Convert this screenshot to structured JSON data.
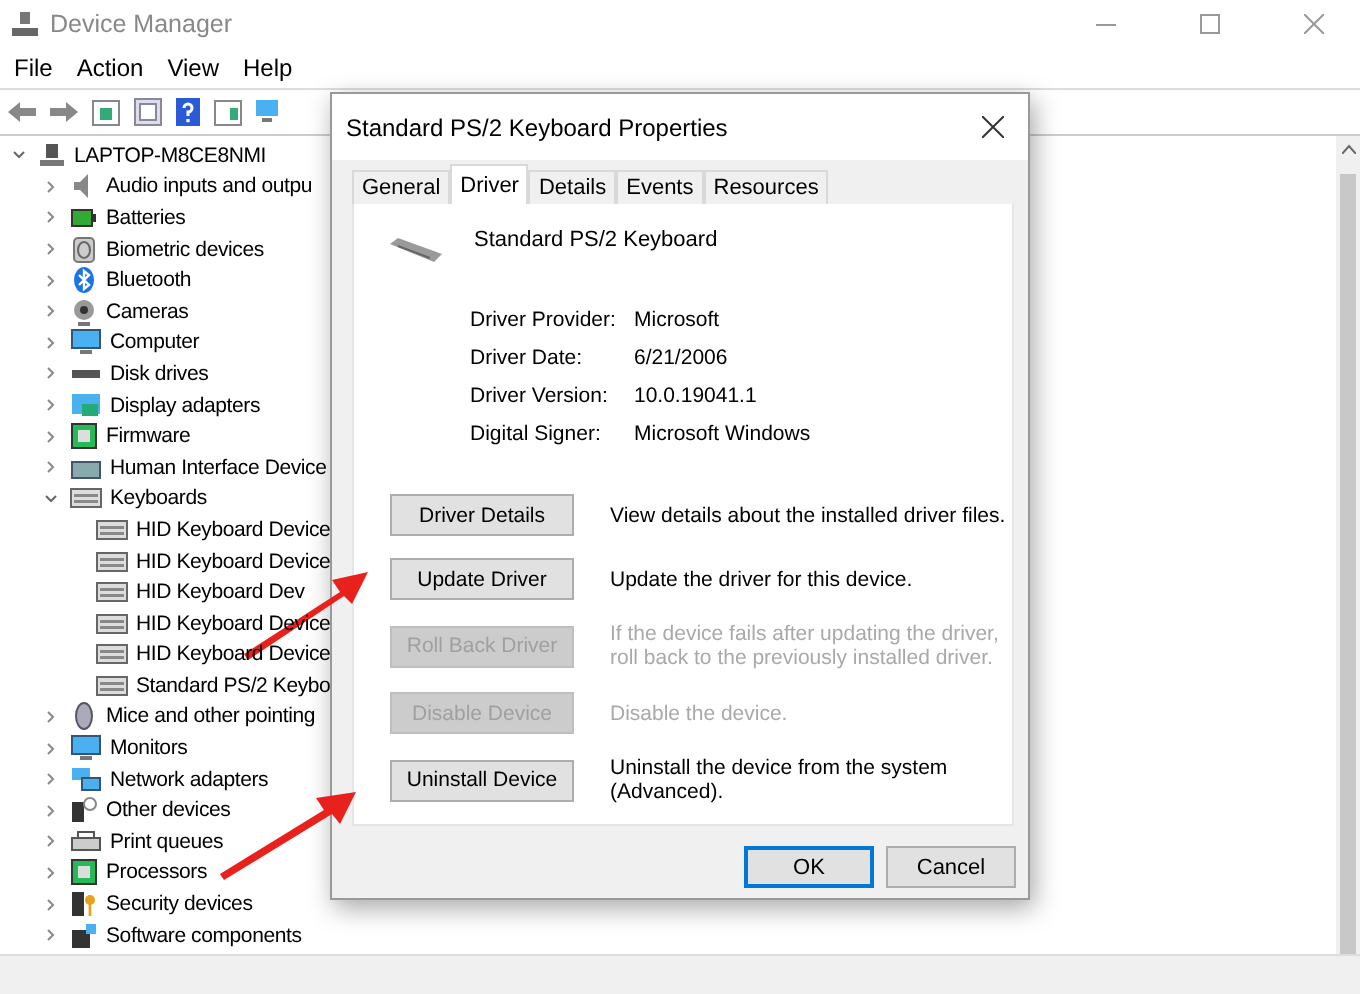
{
  "window": {
    "title": "Device Manager"
  },
  "menu": [
    "File",
    "Action",
    "View",
    "Help"
  ],
  "tree": {
    "label": "LAPTOP-M8CE8NMI",
    "expanded": true,
    "children": [
      {
        "label": "Audio inputs and outpu",
        "expanded": false
      },
      {
        "label": "Batteries",
        "expanded": false
      },
      {
        "label": "Biometric devices",
        "expanded": false
      },
      {
        "label": "Bluetooth",
        "expanded": false
      },
      {
        "label": "Cameras",
        "expanded": false
      },
      {
        "label": "Computer",
        "expanded": false
      },
      {
        "label": "Disk drives",
        "expanded": false
      },
      {
        "label": "Display adapters",
        "expanded": false
      },
      {
        "label": "Firmware",
        "expanded": false
      },
      {
        "label": "Human Interface Device",
        "expanded": false
      },
      {
        "label": "Keyboards",
        "expanded": true,
        "children": [
          {
            "label": "HID Keyboard Device"
          },
          {
            "label": "HID Keyboard Device"
          },
          {
            "label": "HID Keyboard Dev"
          },
          {
            "label": "HID Keyboard Device"
          },
          {
            "label": "HID Keyboard Device"
          },
          {
            "label": "Standard PS/2 Keybo"
          }
        ]
      },
      {
        "label": "Mice and other pointing",
        "expanded": false
      },
      {
        "label": "Monitors",
        "expanded": false
      },
      {
        "label": "Network adapters",
        "expanded": false
      },
      {
        "label": "Other devices",
        "expanded": false
      },
      {
        "label": "Print queues",
        "expanded": false
      },
      {
        "label": "Processors",
        "expanded": false
      },
      {
        "label": "Security devices",
        "expanded": false
      },
      {
        "label": "Software components",
        "expanded": false
      }
    ]
  },
  "dialog": {
    "title": "Standard PS/2 Keyboard Properties",
    "tabs": [
      {
        "label": "General",
        "selected": false
      },
      {
        "label": "Driver",
        "selected": true
      },
      {
        "label": "Details",
        "selected": false
      },
      {
        "label": "Events",
        "selected": false
      },
      {
        "label": "Resources",
        "selected": false
      }
    ],
    "device_name": "Standard PS/2 Keyboard",
    "info": [
      {
        "label": "Driver Provider:",
        "value": "Microsoft"
      },
      {
        "label": "Driver Date:",
        "value": "6/21/2006"
      },
      {
        "label": "Driver Version:",
        "value": "10.0.19041.1"
      },
      {
        "label": "Digital Signer:",
        "value": "Microsoft Windows"
      }
    ],
    "actions": [
      {
        "button": "Driver Details",
        "description": "View details about the installed driver files.",
        "disabled": false
      },
      {
        "button": "Update Driver",
        "description": "Update the driver for this device.",
        "disabled": false
      },
      {
        "button": "Roll Back Driver",
        "description": "If the device fails after updating the driver, roll back to the previously installed driver.",
        "disabled": true
      },
      {
        "button": "Disable Device",
        "description": "Disable the device.",
        "disabled": true
      },
      {
        "button": "Uninstall Device",
        "description": "Uninstall the device from the system (Advanced).",
        "disabled": false
      }
    ],
    "buttons": [
      {
        "label": "OK",
        "kind": "default"
      },
      {
        "label": "Cancel",
        "kind": "normal"
      }
    ]
  }
}
